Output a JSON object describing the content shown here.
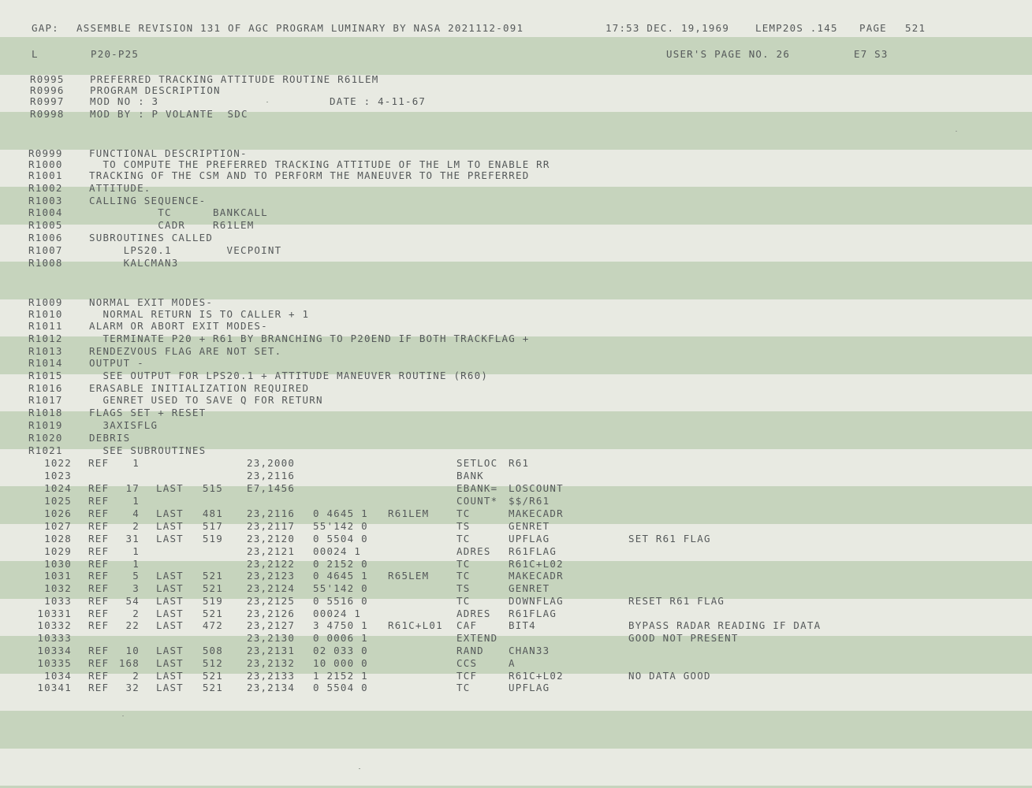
{
  "header": {
    "gap": "GAP:",
    "assemble": "ASSEMBLE REVISION 131 OF AGC PROGRAM LUMINARY BY NASA 2021112-091",
    "time": "17:53 DEC. 19,1969",
    "lemp": "LEMP20S .145",
    "page_label": "PAGE",
    "page_no": "521"
  },
  "subheader": {
    "l": "L",
    "section": "P20-P25",
    "users_page": "USER'S PAGE NO. 26",
    "bank": "E7 S3"
  },
  "desc_lines": [
    {
      "id": "R0995",
      "text": "PREFERRED TRACKING ATTITUDE ROUTINE R61LEM",
      "extra": ""
    },
    {
      "id": "R0996",
      "text": "PROGRAM DESCRIPTION",
      "extra": ""
    },
    {
      "id": "R0997",
      "text": "MOD NO : 3",
      "extra": "DATE : 4-11-67"
    },
    {
      "id": "R0998",
      "text": "MOD BY : P VOLANTE  SDC",
      "extra": ""
    },
    {
      "id": "R0999",
      "text": "FUNCTIONAL DESCRIPTION-",
      "extra": ""
    },
    {
      "id": "R1000",
      "text": "  TO COMPUTE THE PREFERRED TRACKING ATTITUDE OF THE LM TO ENABLE RR",
      "extra": ""
    },
    {
      "id": "R1001",
      "text": "TRACKING OF THE CSM AND TO PERFORM THE MANEUVER TO THE PREFERRED",
      "extra": ""
    },
    {
      "id": "R1002",
      "text": "ATTITUDE.",
      "extra": ""
    },
    {
      "id": "R1003",
      "text": "CALLING SEQUENCE-",
      "extra": ""
    },
    {
      "id": "R1004",
      "text": "          TC      BANKCALL",
      "extra": ""
    },
    {
      "id": "R1005",
      "text": "          CADR    R61LEM",
      "extra": ""
    },
    {
      "id": "R1006",
      "text": "SUBROUTINES CALLED",
      "extra": ""
    },
    {
      "id": "R1007",
      "text": "     LPS20.1        VECPOINT",
      "extra": ""
    },
    {
      "id": "R1008",
      "text": "     KALCMAN3",
      "extra": ""
    },
    {
      "id": "R1009",
      "text": "NORMAL EXIT MODES-",
      "extra": ""
    },
    {
      "id": "R1010",
      "text": "  NORMAL RETURN IS TO CALLER + 1",
      "extra": ""
    },
    {
      "id": "R1011",
      "text": "ALARM OR ABORT EXIT MODES-",
      "extra": ""
    },
    {
      "id": "R1012",
      "text": "  TERMINATE P20 + R61 BY BRANCHING TO P20END IF BOTH TRACKFLAG +",
      "extra": ""
    },
    {
      "id": "R1013",
      "text": "RENDEZVOUS FLAG ARE NOT SET.",
      "extra": ""
    },
    {
      "id": "R1014",
      "text": "OUTPUT -",
      "extra": ""
    },
    {
      "id": "R1015",
      "text": "  SEE OUTPUT FOR LPS20.1 + ATTITUDE MANEUVER ROUTINE (R60)",
      "extra": ""
    },
    {
      "id": "R1016",
      "text": "ERASABLE INITIALIZATION REQUIRED",
      "extra": ""
    },
    {
      "id": "R1017",
      "text": "  GENRET USED TO SAVE Q FOR RETURN",
      "extra": ""
    },
    {
      "id": "R1018",
      "text": "FLAGS SET + RESET",
      "extra": ""
    },
    {
      "id": "R1019",
      "text": "  3AXISFLG",
      "extra": ""
    },
    {
      "id": "R1020",
      "text": "DEBRIS",
      "extra": ""
    },
    {
      "id": "R1021",
      "text": "  SEE SUBROUTINES",
      "extra": ""
    }
  ],
  "code_lines": [
    {
      "line": "1022",
      "ref": "REF",
      "refno": "1",
      "last": "",
      "lastno": "",
      "addr": "23,2000",
      "oct": "",
      "label": "",
      "op": "SETLOC",
      "operand": "R61",
      "comment": ""
    },
    {
      "line": "1023",
      "ref": "",
      "refno": "",
      "last": "",
      "lastno": "",
      "addr": "23,2116",
      "oct": "",
      "label": "",
      "op": "BANK",
      "operand": "",
      "comment": ""
    },
    {
      "line": "1024",
      "ref": "REF",
      "refno": "17",
      "last": "LAST",
      "lastno": "515",
      "addr": "E7,1456",
      "oct": "",
      "label": "",
      "op": "EBANK=",
      "operand": "LOSCOUNT",
      "comment": ""
    },
    {
      "line": "1025",
      "ref": "REF",
      "refno": "1",
      "last": "",
      "lastno": "",
      "addr": "",
      "oct": "",
      "label": "",
      "op": "COUNT*",
      "operand": "$$/R61",
      "comment": ""
    },
    {
      "line": "1026",
      "ref": "REF",
      "refno": "4",
      "last": "LAST",
      "lastno": "481",
      "addr": "23,2116",
      "oct": "0 4645 1",
      "label": "R61LEM",
      "op": "TC",
      "operand": "MAKECADR",
      "comment": ""
    },
    {
      "line": "1027",
      "ref": "REF",
      "refno": "2",
      "last": "LAST",
      "lastno": "517",
      "addr": "23,2117",
      "oct": "55'142 0",
      "label": "",
      "op": "TS",
      "operand": "GENRET",
      "comment": ""
    },
    {
      "line": "1028",
      "ref": "REF",
      "refno": "31",
      "last": "LAST",
      "lastno": "519",
      "addr": "23,2120",
      "oct": "0 5504 0",
      "label": "",
      "op": "TC",
      "operand": "UPFLAG",
      "comment": "SET R61 FLAG"
    },
    {
      "line": "1029",
      "ref": "REF",
      "refno": "1",
      "last": "",
      "lastno": "",
      "addr": "23,2121",
      "oct": "00024 1",
      "label": "",
      "op": "ADRES",
      "operand": "R61FLAG",
      "comment": ""
    },
    {
      "line": "1030",
      "ref": "REF",
      "refno": "1",
      "last": "",
      "lastno": "",
      "addr": "23,2122",
      "oct": "0 2152 0",
      "label": "",
      "op": "TC",
      "operand": "R61C+L02",
      "comment": ""
    },
    {
      "line": "1031",
      "ref": "REF",
      "refno": "5",
      "last": "LAST",
      "lastno": "521",
      "addr": "23,2123",
      "oct": "0 4645 1",
      "label": "R65LEM",
      "op": "TC",
      "operand": "MAKECADR",
      "comment": ""
    },
    {
      "line": "1032",
      "ref": "REF",
      "refno": "3",
      "last": "LAST",
      "lastno": "521",
      "addr": "23,2124",
      "oct": "55'142 0",
      "label": "",
      "op": "TS",
      "operand": "GENRET",
      "comment": ""
    },
    {
      "line": "1033",
      "ref": "REF",
      "refno": "54",
      "last": "LAST",
      "lastno": "519",
      "addr": "23,2125",
      "oct": "0 5516 0",
      "label": "",
      "op": "TC",
      "operand": "DOWNFLAG",
      "comment": "RESET R61 FLAG"
    },
    {
      "line": "10331",
      "ref": "REF",
      "refno": "2",
      "last": "LAST",
      "lastno": "521",
      "addr": "23,2126",
      "oct": "00024 1",
      "label": "",
      "op": "ADRES",
      "operand": "R61FLAG",
      "comment": ""
    },
    {
      "line": "10332",
      "ref": "REF",
      "refno": "22",
      "last": "LAST",
      "lastno": "472",
      "addr": "23,2127",
      "oct": "3 4750 1",
      "label": "R61C+L01",
      "op": "CAF",
      "operand": "BIT4",
      "comment": "BYPASS RADAR READING IF DATA"
    },
    {
      "line": "10333",
      "ref": "",
      "refno": "",
      "last": "",
      "lastno": "",
      "addr": "23,2130",
      "oct": "0 0006 1",
      "label": "",
      "op": "EXTEND",
      "operand": "",
      "comment": "GOOD NOT PRESENT"
    },
    {
      "line": "10334",
      "ref": "REF",
      "refno": "10",
      "last": "LAST",
      "lastno": "508",
      "addr": "23,2131",
      "oct": "02 033 0",
      "label": "",
      "op": "RAND",
      "operand": "CHAN33",
      "comment": ""
    },
    {
      "line": "10335",
      "ref": "REF",
      "refno": "168",
      "last": "LAST",
      "lastno": "512",
      "addr": "23,2132",
      "oct": "10 000 0",
      "label": "",
      "op": "CCS",
      "operand": "A",
      "comment": ""
    },
    {
      "line": "1034",
      "ref": "REF",
      "refno": "2",
      "last": "LAST",
      "lastno": "521",
      "addr": "23,2133",
      "oct": "1 2152 1",
      "label": "",
      "op": "TCF",
      "operand": "R61C+L02",
      "comment": "NO DATA GOOD"
    },
    {
      "line": "10341",
      "ref": "REF",
      "refno": "32",
      "last": "LAST",
      "lastno": "521",
      "addr": "23,2134",
      "oct": "0 5504 0",
      "label": "",
      "op": "TC",
      "operand": "UPFLAG",
      "comment": ""
    }
  ]
}
